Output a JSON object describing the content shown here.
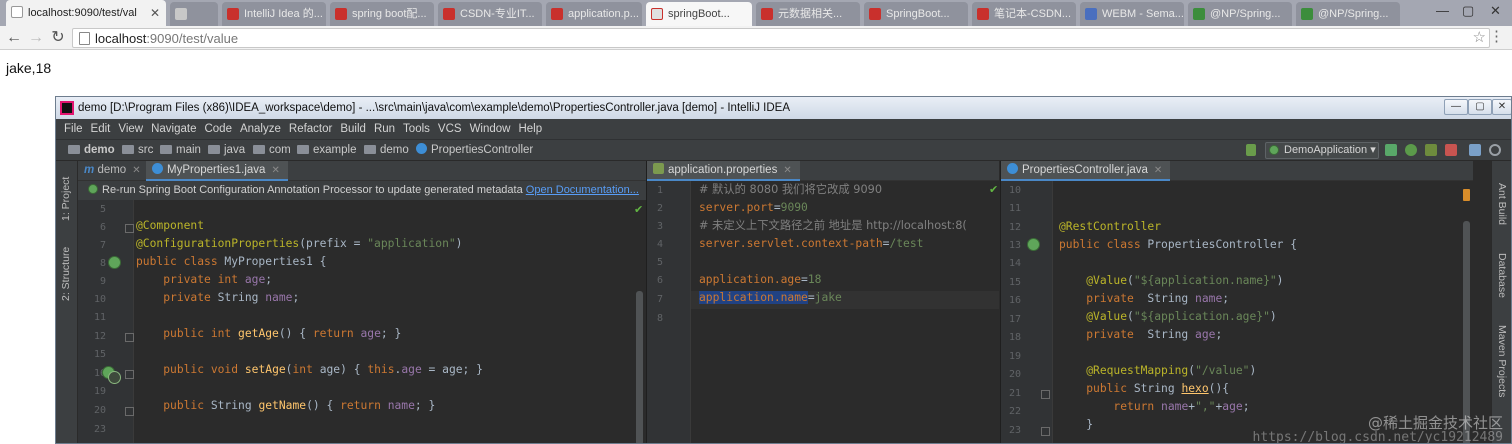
{
  "browser": {
    "tabs": [
      {
        "label": "localhost:9090/test/val",
        "active": true,
        "favicon_color": "#ffffff"
      },
      {
        "label": "",
        "active": false,
        "favicon_color": "#c8c8c8"
      },
      {
        "label": "IntelliJ Idea 的...",
        "active": false,
        "favicon_color": "#c9302c"
      },
      {
        "label": "spring boot配...",
        "active": false,
        "favicon_color": "#c9302c"
      },
      {
        "label": "CSDN-专业IT...",
        "active": false,
        "favicon_color": "#c9302c"
      },
      {
        "label": "application.p...",
        "active": false,
        "favicon_color": "#c9302c"
      },
      {
        "label": "springBoot...",
        "active": false,
        "favicon_color": "#e0e0e0"
      },
      {
        "label": "元数据相关...",
        "active": false,
        "favicon_color": "#c9302c"
      },
      {
        "label": "SpringBoot...",
        "active": false,
        "favicon_color": "#c9302c"
      },
      {
        "label": "笔记本-CSDN...",
        "active": false,
        "favicon_color": "#c9302c"
      },
      {
        "label": "WEBM - Sema...",
        "active": false,
        "favicon_color": "#4a6fbf"
      },
      {
        "label": "@NP/Spring...",
        "active": false,
        "favicon_color": "#3c8d3c"
      },
      {
        "label": "@NP/Spring...",
        "active": false,
        "favicon_color": "#3c8d3c"
      }
    ],
    "url_host": "localhost",
    "url_rest": ":9090/test/value"
  },
  "page": {
    "body_text": "jake,18"
  },
  "ide": {
    "title": "demo [D:\\Program Files (x86)\\IDEA_workspace\\demo] - ...\\src\\main\\java\\com\\example\\demo\\PropertiesController.java [demo] - IntelliJ IDEA",
    "menu": [
      "File",
      "Edit",
      "View",
      "Navigate",
      "Code",
      "Analyze",
      "Refactor",
      "Build",
      "Run",
      "Tools",
      "VCS",
      "Window",
      "Help"
    ],
    "breadcrumb": [
      "demo",
      "src",
      "main",
      "java",
      "com",
      "example",
      "demo",
      "PropertiesController"
    ],
    "run_config": "DemoApplication",
    "left_tools": [
      "1: Project",
      "2: Structure"
    ],
    "right_tools": [
      "Ant Build",
      "Database",
      "Maven Projects"
    ],
    "pane1": {
      "tabs": [
        "demo",
        "MyProperties1.java"
      ],
      "notice_text": "Re-run Spring Boot Configuration Annotation Processor to update generated metadata",
      "notice_link": "Open Documentation...",
      "lines": [
        "5",
        "6",
        "7",
        "8",
        "9",
        "10",
        "11",
        "12",
        "15",
        "16",
        "19",
        "20",
        "23"
      ]
    },
    "pane2": {
      "tab": "application.properties",
      "lines": [
        "1",
        "2",
        "3",
        "4",
        "5",
        "6",
        "7",
        "8"
      ],
      "comment1": "# 默认的 8080 我们将它改成 9090",
      "k_port": "server.port",
      "v_port": "9090",
      "comment2": "# 未定义上下文路径之前 地址是 http://localhost:8(",
      "k_ctx": "server.servlet.context-path",
      "v_ctx": "/test",
      "k_age": "application.age",
      "v_age": "18",
      "k_name": "application.name",
      "v_name": "jake"
    },
    "pane3": {
      "tab": "PropertiesController.java",
      "lines": [
        "10",
        "11",
        "12",
        "13",
        "14",
        "15",
        "16",
        "17",
        "18",
        "19",
        "20",
        "21",
        "22",
        "23"
      ]
    }
  },
  "watermark": {
    "line1": "@稀土掘金技术社区",
    "line2": "https://blog.csdn.net/yc19212489"
  }
}
